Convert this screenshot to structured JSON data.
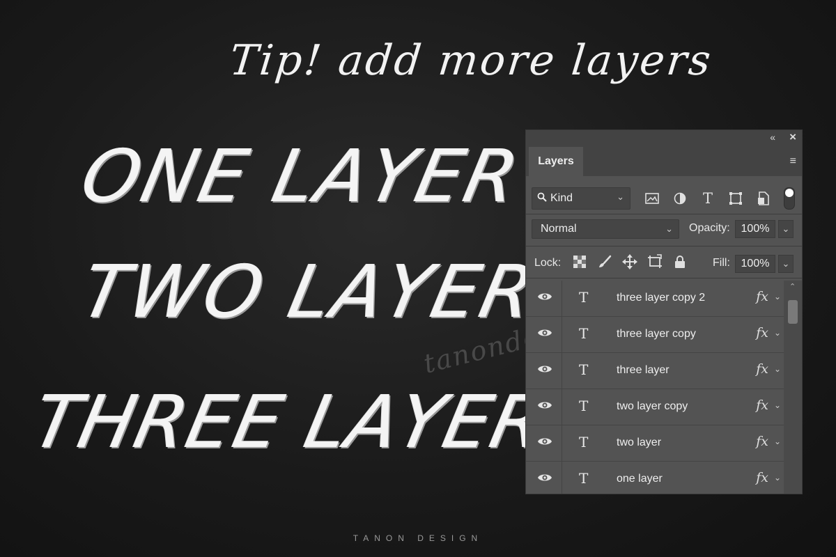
{
  "headline": {
    "tip": "Tip! add more layers",
    "line1": "ONE LAYER",
    "line2": "TWO LAYER",
    "line3": "THREE LAYER"
  },
  "watermark": "tanondesign",
  "footer": "TANON DESIGN",
  "panel": {
    "tab_label": "Layers",
    "filter_kind": "Kind",
    "blend_mode": "Normal",
    "opacity_label": "Opacity:",
    "opacity_value": "100%",
    "lock_label": "Lock:",
    "fill_label": "Fill:",
    "fill_value": "100%",
    "layers": [
      {
        "name": "three layer copy 2",
        "fx": "fx"
      },
      {
        "name": "three layer copy",
        "fx": "fx"
      },
      {
        "name": "three layer",
        "fx": "fx"
      },
      {
        "name": "two layer copy",
        "fx": "fx"
      },
      {
        "name": "two layer",
        "fx": "fx"
      },
      {
        "name": "one layer",
        "fx": "fx"
      }
    ],
    "layer_type_glyph": "T"
  },
  "colors": {
    "background": "#1a1a1a",
    "panel": "#535353",
    "panel_dark": "#434343"
  }
}
